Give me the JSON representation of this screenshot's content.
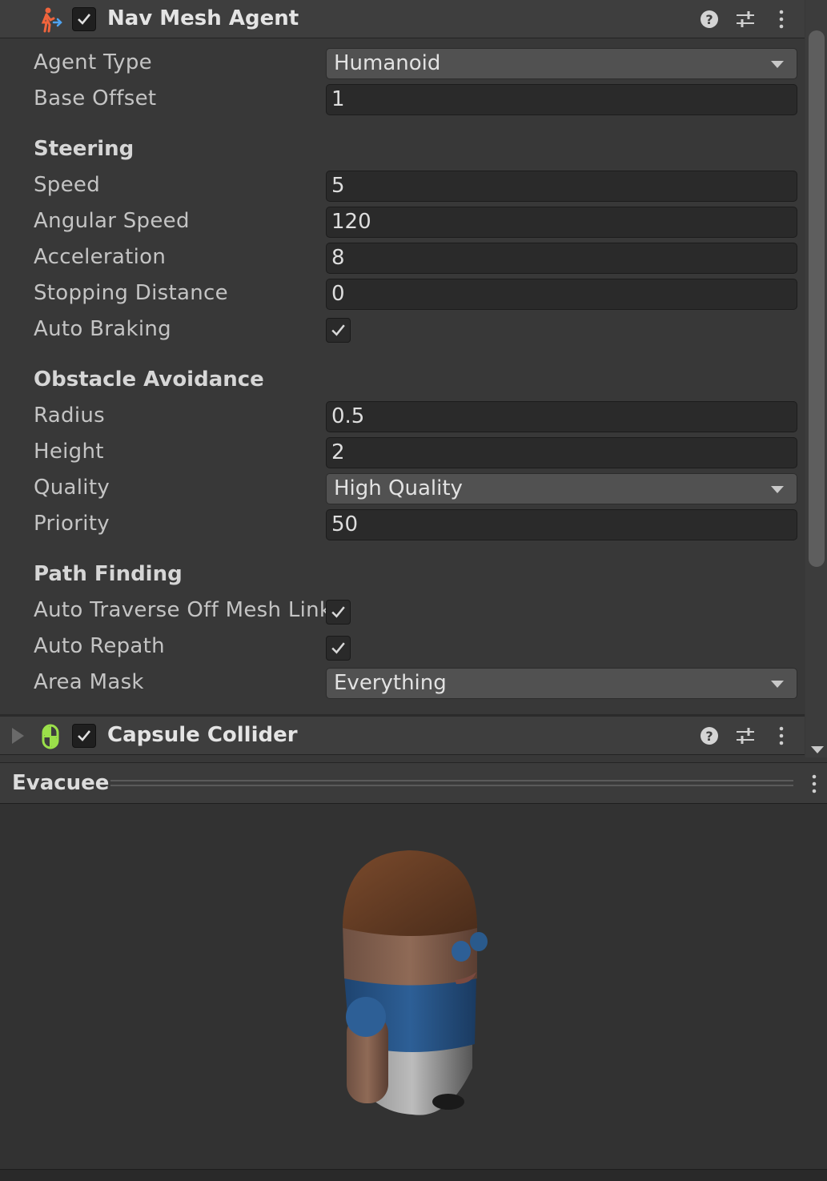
{
  "nav_mesh_agent": {
    "title": "Nav Mesh Agent",
    "enabled": true,
    "expanded": true,
    "icon": "nav-mesh-agent-icon",
    "agent_type": {
      "label": "Agent Type",
      "value": "Humanoid"
    },
    "base_offset": {
      "label": "Base Offset",
      "value": "1"
    },
    "steering": {
      "heading": "Steering",
      "speed": {
        "label": "Speed",
        "value": "5"
      },
      "angular_speed": {
        "label": "Angular Speed",
        "value": "120"
      },
      "acceleration": {
        "label": "Acceleration",
        "value": "8"
      },
      "stopping_distance": {
        "label": "Stopping Distance",
        "value": "0"
      },
      "auto_braking": {
        "label": "Auto Braking",
        "checked": true
      }
    },
    "obstacle_avoidance": {
      "heading": "Obstacle Avoidance",
      "radius": {
        "label": "Radius",
        "value": "0.5"
      },
      "height": {
        "label": "Height",
        "value": "2"
      },
      "quality": {
        "label": "Quality",
        "value": "High Quality"
      },
      "priority": {
        "label": "Priority",
        "value": "50"
      }
    },
    "path_finding": {
      "heading": "Path Finding",
      "auto_traverse": {
        "label": "Auto Traverse Off Mesh Link",
        "checked": true
      },
      "auto_repath": {
        "label": "Auto Repath",
        "checked": true
      },
      "area_mask": {
        "label": "Area Mask",
        "value": "Everything"
      }
    }
  },
  "capsule_collider": {
    "title": "Capsule Collider",
    "enabled": true,
    "expanded": false,
    "icon": "capsule-collider-icon"
  },
  "preview": {
    "title": "Evacuee"
  },
  "colors": {
    "agent_icon": "#f0643c",
    "collider_icon": "#9be04a",
    "body_blue": "#2d5f96",
    "hair_brown": "#6b4127",
    "skin": "#8a6450"
  }
}
